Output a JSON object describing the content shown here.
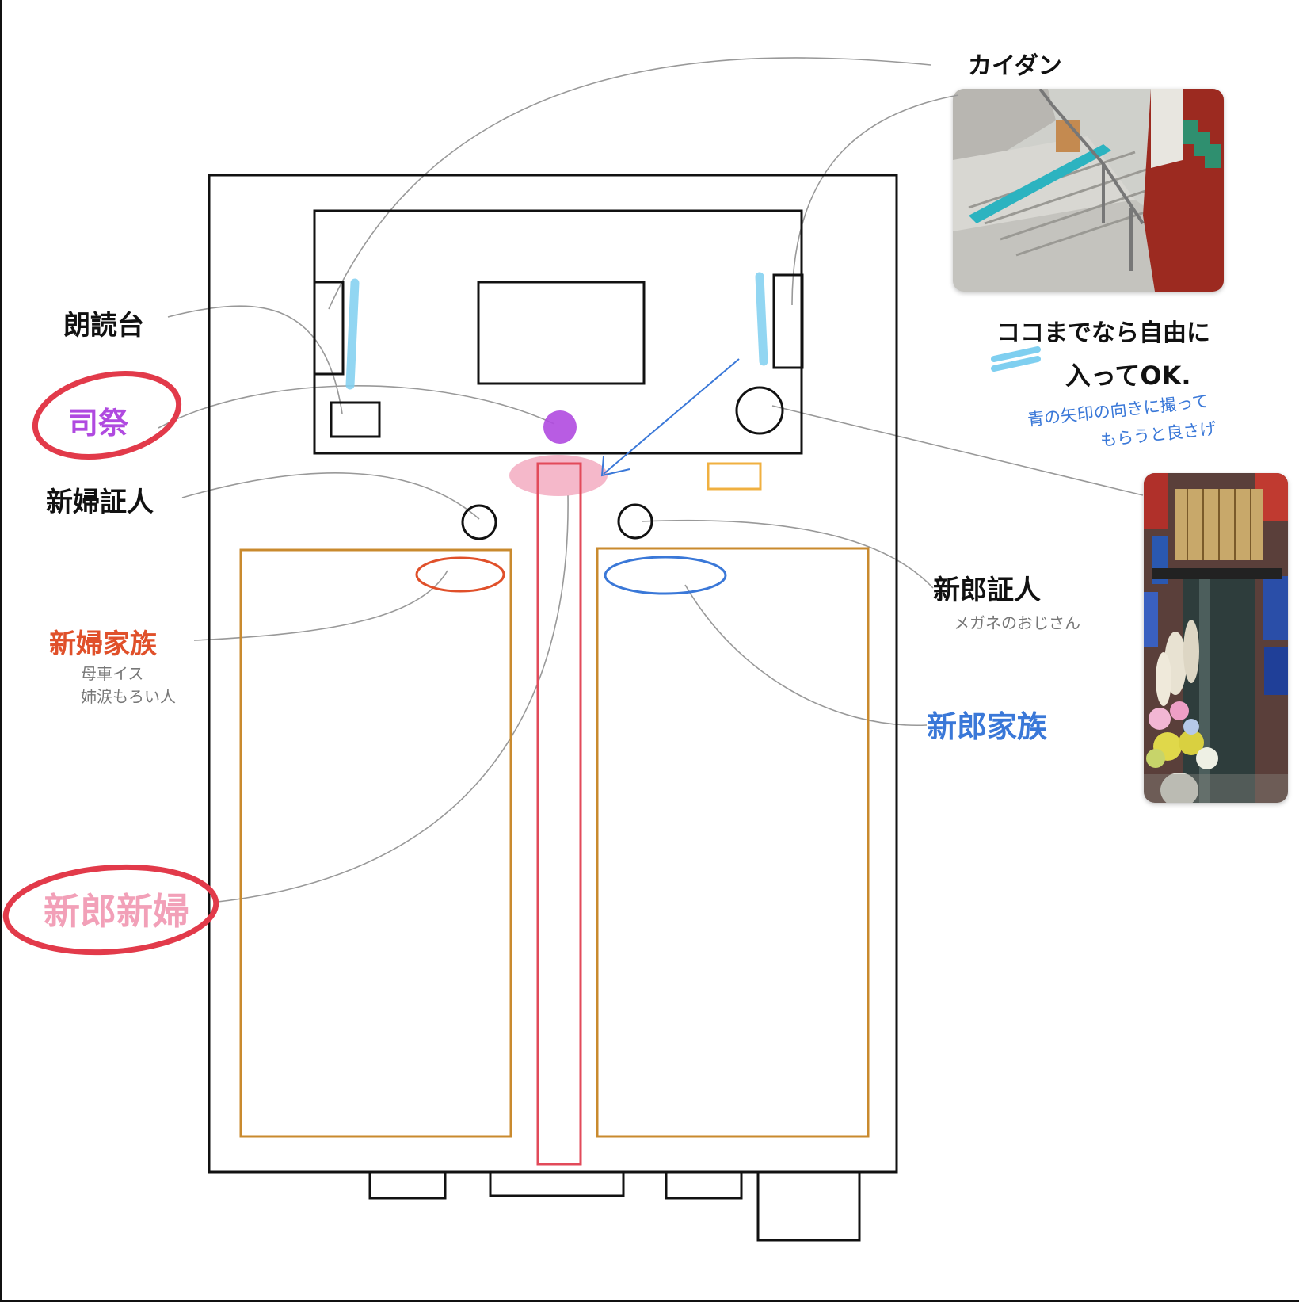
{
  "labels": {
    "stairs": "カイダン",
    "lectern": "朗読台",
    "priest": "司祭",
    "bride_witness": "新婦証人",
    "groom_witness": "新郎証人",
    "groom_witness_note": "メガネのおじさん",
    "bride_family": "新婦家族",
    "bride_family_note_1": "母車イス",
    "bride_family_note_2": "姉涙もろい人",
    "groom_family": "新郎家族",
    "couple": "新郎新婦",
    "free_zone_1": "ココまでなら自由に",
    "free_zone_2": "入ってOK.",
    "arrow_note_1": "青の矢印の向きに撮って",
    "arrow_note_2": "もらうと良さげ"
  },
  "colors": {
    "outline": "#111111",
    "pew": "#c98a2e",
    "aisle": "#e24a5a",
    "priest": "#b04ae0",
    "couple_fill": "#f2a0b8",
    "bride_family": "#e0502a",
    "groom_family": "#3a78d8",
    "stairs_mark": "#7fcff0",
    "leader_line": "#999999",
    "highlight_circle": "#e23a4a",
    "orange_box": "#f0b040"
  },
  "photos": {
    "stairs_photo": "stairs-photo",
    "candle_photo": "candle-flower-photo"
  }
}
